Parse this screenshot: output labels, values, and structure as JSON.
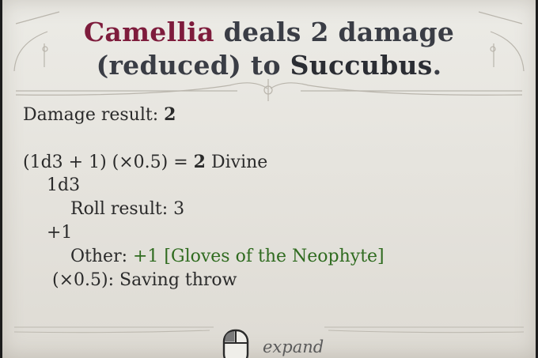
{
  "header": {
    "actor": "Camellia",
    "middle": "deals 2 damage (reduced) to",
    "target": "Succubus",
    "end": "."
  },
  "body": {
    "damage_result_label": "Damage result:",
    "damage_result_value": "2",
    "formula_prefix": "(1d3 + 1) (×0.5) =",
    "formula_total": "2",
    "formula_type": "Divine",
    "dice_label": "1d3",
    "roll_result_label": "Roll result:",
    "roll_result_value": "3",
    "bonus_label": "+1",
    "other_label": "Other:",
    "other_value": "+1 [Gloves of the Neophyte]",
    "multiplier_line": "(×0.5): Saving throw"
  },
  "footer": {
    "expand_label": "expand",
    "icon": "mouse-icon"
  },
  "colors": {
    "actor": "#7e1c3c",
    "positive": "#2f6b1f",
    "parchment": "#e8e6e0"
  }
}
